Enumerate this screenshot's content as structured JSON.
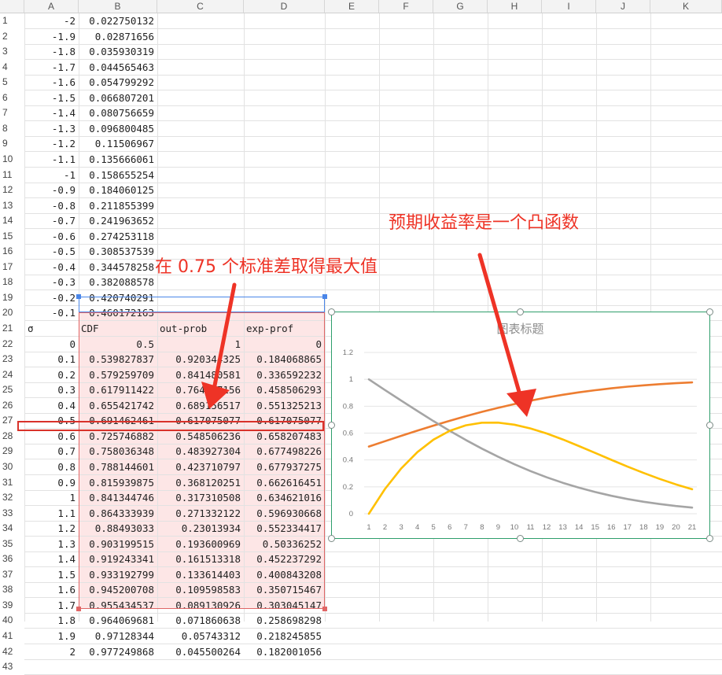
{
  "columns": [
    "A",
    "B",
    "C",
    "D",
    "E",
    "F",
    "G",
    "H",
    "I",
    "J",
    "K"
  ],
  "rows_top": [
    {
      "n": "1",
      "a": "-2",
      "b": "0.022750132"
    },
    {
      "n": "2",
      "a": "-1.9",
      "b": "0.02871656"
    },
    {
      "n": "3",
      "a": "-1.8",
      "b": "0.035930319"
    },
    {
      "n": "4",
      "a": "-1.7",
      "b": "0.044565463"
    },
    {
      "n": "5",
      "a": "-1.6",
      "b": "0.054799292"
    },
    {
      "n": "6",
      "a": "-1.5",
      "b": "0.066807201"
    },
    {
      "n": "7",
      "a": "-1.4",
      "b": "0.080756659"
    },
    {
      "n": "8",
      "a": "-1.3",
      "b": "0.096800485"
    },
    {
      "n": "9",
      "a": "-1.2",
      "b": "0.11506967"
    },
    {
      "n": "10",
      "a": "-1.1",
      "b": "0.135666061"
    },
    {
      "n": "11",
      "a": "-1",
      "b": "0.158655254"
    },
    {
      "n": "12",
      "a": "-0.9",
      "b": "0.184060125"
    },
    {
      "n": "13",
      "a": "-0.8",
      "b": "0.211855399"
    },
    {
      "n": "14",
      "a": "-0.7",
      "b": "0.241963652"
    },
    {
      "n": "15",
      "a": "-0.6",
      "b": "0.274253118"
    },
    {
      "n": "16",
      "a": "-0.5",
      "b": "0.308537539"
    },
    {
      "n": "17",
      "a": "-0.4",
      "b": "0.344578258"
    },
    {
      "n": "18",
      "a": "-0.3",
      "b": "0.382088578"
    },
    {
      "n": "19",
      "a": "-0.2",
      "b": "0.420740291"
    },
    {
      "n": "20",
      "a": "-0.1",
      "b": "0.460172163"
    }
  ],
  "header_row": {
    "n": "21",
    "a": "σ",
    "b": "CDF",
    "c": "out-prob",
    "d": "exp-prof"
  },
  "rows_bottom": [
    {
      "n": "22",
      "a": "0",
      "b": "0.5",
      "c": "1",
      "d": "0"
    },
    {
      "n": "23",
      "a": "0.1",
      "b": "0.539827837",
      "c": "0.920344325",
      "d": "0.184068865"
    },
    {
      "n": "24",
      "a": "0.2",
      "b": "0.579259709",
      "c": "0.841480581",
      "d": "0.336592232"
    },
    {
      "n": "25",
      "a": "0.3",
      "b": "0.617911422",
      "c": "0.764177156",
      "d": "0.458506293"
    },
    {
      "n": "26",
      "a": "0.4",
      "b": "0.655421742",
      "c": "0.689156517",
      "d": "0.551325213"
    },
    {
      "n": "27",
      "a": "0.5",
      "b": "0.691462461",
      "c": "0.617075077",
      "d": "0.617075077"
    },
    {
      "n": "28",
      "a": "0.6",
      "b": "0.725746882",
      "c": "0.548506236",
      "d": "0.658207483"
    },
    {
      "n": "29",
      "a": "0.7",
      "b": "0.758036348",
      "c": "0.483927304",
      "d": "0.677498226"
    },
    {
      "n": "30",
      "a": "0.8",
      "b": "0.788144601",
      "c": "0.423710797",
      "d": "0.677937275"
    },
    {
      "n": "31",
      "a": "0.9",
      "b": "0.815939875",
      "c": "0.368120251",
      "d": "0.662616451"
    },
    {
      "n": "32",
      "a": "1",
      "b": "0.841344746",
      "c": "0.317310508",
      "d": "0.634621016"
    },
    {
      "n": "33",
      "a": "1.1",
      "b": "0.864333939",
      "c": "0.271332122",
      "d": "0.596930668"
    },
    {
      "n": "34",
      "a": "1.2",
      "b": "0.88493033",
      "c": "0.23013934",
      "d": "0.552334417"
    },
    {
      "n": "35",
      "a": "1.3",
      "b": "0.903199515",
      "c": "0.193600969",
      "d": "0.50336252"
    },
    {
      "n": "36",
      "a": "1.4",
      "b": "0.919243341",
      "c": "0.161513318",
      "d": "0.452237292"
    },
    {
      "n": "37",
      "a": "1.5",
      "b": "0.933192799",
      "c": "0.133614403",
      "d": "0.400843208"
    },
    {
      "n": "38",
      "a": "1.6",
      "b": "0.945200708",
      "c": "0.109598583",
      "d": "0.350715467"
    },
    {
      "n": "39",
      "a": "1.7",
      "b": "0.955434537",
      "c": "0.089130926",
      "d": "0.303045147"
    },
    {
      "n": "40",
      "a": "1.8",
      "b": "0.964069681",
      "c": "0.071860638",
      "d": "0.258698298"
    },
    {
      "n": "41",
      "a": "1.9",
      "b": "0.97128344",
      "c": "0.05743312",
      "d": "0.218245855"
    },
    {
      "n": "42",
      "a": "2",
      "b": "0.977249868",
      "c": "0.045500264",
      "d": "0.182001056"
    },
    {
      "n": "43",
      "a": "",
      "b": "",
      "c": "",
      "d": ""
    }
  ],
  "annotations": {
    "left": "在 0.75 个标准差取得最大值",
    "right": "预期收益率是一个凸函数"
  },
  "colors": {
    "annotation_red": "#ee3326",
    "chart_border": "#2e9e6b",
    "table_pink": "#fde6e6",
    "header_blue": "#4a86e8"
  },
  "chart_data": {
    "type": "line",
    "title": "图表标题",
    "categories": [
      "1",
      "2",
      "3",
      "4",
      "5",
      "6",
      "7",
      "8",
      "9",
      "10",
      "11",
      "12",
      "13",
      "14",
      "15",
      "16",
      "17",
      "18",
      "19",
      "20",
      "21"
    ],
    "ylim": [
      0,
      1.2
    ],
    "yticks": [
      "0",
      "0.2",
      "0.4",
      "0.6",
      "0.8",
      "1",
      "1.2"
    ],
    "grid": true,
    "series": [
      {
        "name": "CDF",
        "color": "#ed7d31",
        "values": [
          0.5,
          0.5398,
          0.5793,
          0.6179,
          0.6554,
          0.6915,
          0.7257,
          0.758,
          0.7881,
          0.8159,
          0.8413,
          0.8643,
          0.8849,
          0.9032,
          0.9192,
          0.9332,
          0.9452,
          0.9554,
          0.9641,
          0.9713,
          0.9772
        ]
      },
      {
        "name": "out-prob",
        "color": "#a5a5a5",
        "values": [
          1,
          0.9203,
          0.8415,
          0.7642,
          0.6892,
          0.6171,
          0.5485,
          0.4839,
          0.4237,
          0.3681,
          0.3173,
          0.2713,
          0.2301,
          0.1936,
          0.1615,
          0.1336,
          0.1096,
          0.0891,
          0.0719,
          0.0574,
          0.0455
        ]
      },
      {
        "name": "exp-prof",
        "color": "#ffc000",
        "values": [
          0,
          0.1841,
          0.3366,
          0.4585,
          0.5513,
          0.6171,
          0.6582,
          0.6775,
          0.6779,
          0.6626,
          0.6346,
          0.5969,
          0.5523,
          0.5034,
          0.4522,
          0.4008,
          0.3507,
          0.303,
          0.2587,
          0.2182,
          0.182
        ]
      }
    ]
  }
}
